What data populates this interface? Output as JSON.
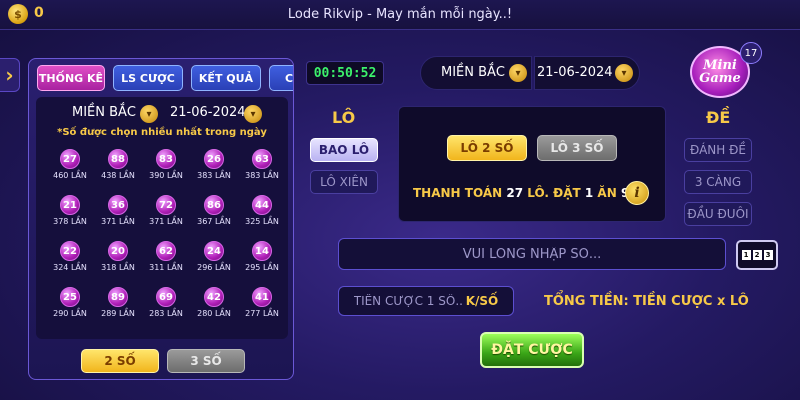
{
  "header": {
    "coin_value": "0",
    "title": "Lode Rikvip - May mắn mỗi ngày..!"
  },
  "left_panel": {
    "tabs": [
      "THỐNG KÊ",
      "LS CƯỢC",
      "KẾT QUẢ",
      "C"
    ],
    "region": "MIỀN BẮC",
    "date": "21-06-2024",
    "note": "*Số được chọn nhiều nhất trong ngày",
    "stats": [
      {
        "num": "27",
        "count": "460 LẦN"
      },
      {
        "num": "88",
        "count": "438 LẦN"
      },
      {
        "num": "83",
        "count": "390 LẦN"
      },
      {
        "num": "26",
        "count": "383 LẦN"
      },
      {
        "num": "63",
        "count": "383 LẦN"
      },
      {
        "num": "21",
        "count": "378 LẦN"
      },
      {
        "num": "36",
        "count": "371 LẦN"
      },
      {
        "num": "72",
        "count": "371 LẦN"
      },
      {
        "num": "86",
        "count": "367 LẦN"
      },
      {
        "num": "44",
        "count": "325 LẦN"
      },
      {
        "num": "22",
        "count": "324 LẦN"
      },
      {
        "num": "20",
        "count": "318 LẦN"
      },
      {
        "num": "62",
        "count": "311 LẦN"
      },
      {
        "num": "24",
        "count": "296 LẦN"
      },
      {
        "num": "14",
        "count": "295 LẦN"
      },
      {
        "num": "25",
        "count": "290 LẦN"
      },
      {
        "num": "89",
        "count": "289 LẦN"
      },
      {
        "num": "69",
        "count": "283 LẦN"
      },
      {
        "num": "42",
        "count": "280 LẦN"
      },
      {
        "num": "41",
        "count": "277 LẦN"
      }
    ],
    "two_digit_label": "2 SỐ",
    "three_digit_label": "3 SỐ"
  },
  "timer": "00:50:52",
  "main": {
    "region": "MIỀN BẮC",
    "date": "21-06-2024",
    "lo_title": "LÔ",
    "lo_options": [
      "BAO LÔ",
      "LÔ XIÊN"
    ],
    "de_title": "ĐỀ",
    "de_options": [
      "ĐÁNH ĐỀ",
      "3 CÀNG",
      "ĐẦU ĐUÔI"
    ],
    "sub_tabs": [
      "LÔ 2 SỐ",
      "LÔ 3 SỐ"
    ],
    "payout": {
      "prefix": "THANH TOÁN",
      "pay_value": "27",
      "mid": "LÔ. ĐẶT",
      "bet_value": "1",
      "win_label": "ĂN",
      "win_value": "99"
    },
    "number_placeholder": "VUI LÒNG NHẬP SỐ...",
    "stake_placeholder": "TIỀN CƯỢC 1 SỐ...",
    "stake_unit": "K/SỐ",
    "total_label": "TỔNG TIỀN: TIỀN CƯỢC x LÔ",
    "bet_button": "ĐẶT CƯỢC"
  },
  "minigame": {
    "label_line1": "Mini",
    "label_line2": "Game",
    "badge": "17"
  },
  "colors": {
    "accent_gold": "#f7c948",
    "timer_green": "#3cf26b",
    "ball_purple": "#b01fb8",
    "bet_green": "#3aa617"
  }
}
